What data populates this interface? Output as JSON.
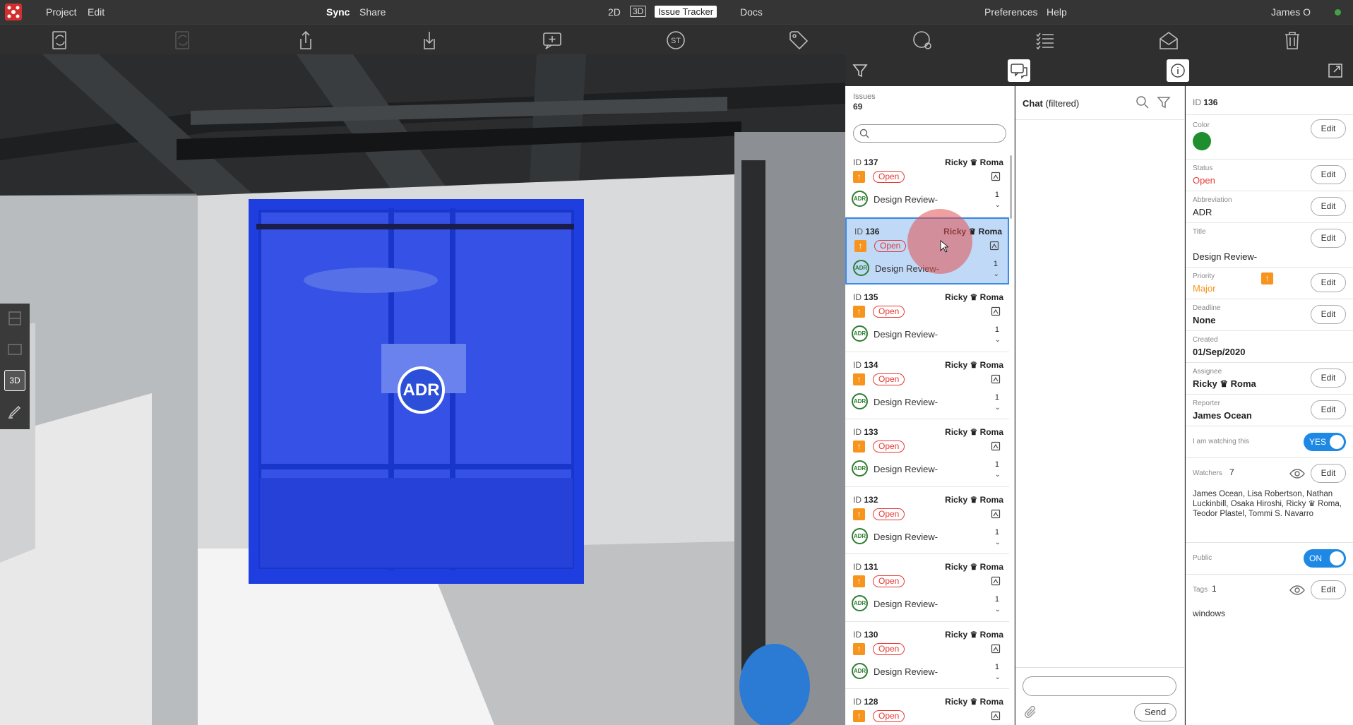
{
  "menubar": {
    "project": "Project",
    "edit": "Edit",
    "sync": "Sync",
    "share": "Share",
    "mode_2d": "2D",
    "mode_3d": "3D",
    "issue_tracker": "Issue Tracker",
    "docs": "Docs",
    "preferences": "Preferences",
    "help": "Help",
    "user": "James O"
  },
  "toolbar": {
    "icons": [
      "sync-document-icon",
      "sync-document-disabled-icon",
      "share-export-icon",
      "download-icon",
      "add-comment-icon",
      "st-icon",
      "tag-icon",
      "st-settings-icon",
      "checklist-icon",
      "mail-icon",
      "trash-icon"
    ],
    "st_label": "ST"
  },
  "viewport": {
    "marker_label": "ADR",
    "tool_3d": "3D"
  },
  "issues_panel": {
    "label": "Issues",
    "count": "69",
    "items": [
      {
        "id": "137",
        "assignee_first": "Ricky",
        "assignee_last": "Roma",
        "status": "Open",
        "abbr": "ADR",
        "title": "Design Review-",
        "count": "1"
      },
      {
        "id": "136",
        "assignee_first": "Ricky",
        "assignee_last": "Roma",
        "status": "Open",
        "abbr": "ADR",
        "title": "Design Review-",
        "count": "1"
      },
      {
        "id": "135",
        "assignee_first": "Ricky",
        "assignee_last": "Roma",
        "status": "Open",
        "abbr": "ADR",
        "title": "Design Review-",
        "count": "1"
      },
      {
        "id": "134",
        "assignee_first": "Ricky",
        "assignee_last": "Roma",
        "status": "Open",
        "abbr": "ADR",
        "title": "Design Review-",
        "count": "1"
      },
      {
        "id": "133",
        "assignee_first": "Ricky",
        "assignee_last": "Roma",
        "status": "Open",
        "abbr": "ADR",
        "title": "Design Review-",
        "count": "1"
      },
      {
        "id": "132",
        "assignee_first": "Ricky",
        "assignee_last": "Roma",
        "status": "Open",
        "abbr": "ADR",
        "title": "Design Review-",
        "count": "1"
      },
      {
        "id": "131",
        "assignee_first": "Ricky",
        "assignee_last": "Roma",
        "status": "Open",
        "abbr": "ADR",
        "title": "Design Review-",
        "count": "1"
      },
      {
        "id": "130",
        "assignee_first": "Ricky",
        "assignee_last": "Roma",
        "status": "Open",
        "abbr": "ADR",
        "title": "Design Review-",
        "count": "1"
      },
      {
        "id": "128",
        "assignee_first": "Ricky",
        "assignee_last": "Roma",
        "status": "Open",
        "abbr": "ADR",
        "title": "Design Review-",
        "count": "1"
      }
    ],
    "id_prefix": "ID"
  },
  "chat": {
    "title": "Chat",
    "filter_note": "(filtered)",
    "send": "Send"
  },
  "details": {
    "id_prefix": "ID",
    "id": "136",
    "color_label": "Color",
    "color_value": "#1e8e2e",
    "status_label": "Status",
    "status_value": "Open",
    "abbreviation_label": "Abbreviation",
    "abbreviation_value": "ADR",
    "title_label": "Title",
    "title_value": "Design Review-",
    "priority_label": "Priority",
    "priority_value": "Major",
    "deadline_label": "Deadline",
    "deadline_value": "None",
    "created_label": "Created",
    "created_value": "01/Sep/2020",
    "assignee_label": "Assignee",
    "assignee_first": "Ricky",
    "assignee_last": "Roma",
    "reporter_label": "Reporter",
    "reporter_value": "James Ocean",
    "watching_label": "I am watching this",
    "watching_toggle": "YES",
    "watchers_label": "Watchers",
    "watchers_count": "7",
    "watchers_list": "James Ocean, Lisa Robertson, Nathan Luckinbill, Osaka Hiroshi, Ricky ♛ Roma, Teodor Plastel, Tommi S. Navarro",
    "public_label": "Public",
    "public_toggle": "ON",
    "tags_label": "Tags",
    "tags_count": "1",
    "tags_value": "windows",
    "edit": "Edit"
  },
  "colors": {
    "accent": "#1e88e5",
    "status_open": "#e53935",
    "priority_major": "#f7941d",
    "selection": "#bfd9f7"
  }
}
